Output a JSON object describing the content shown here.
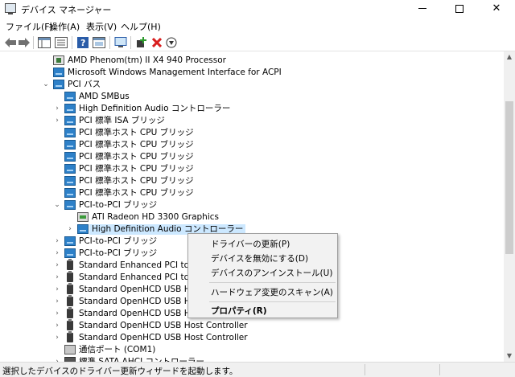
{
  "window": {
    "title": "デバイス マネージャー",
    "min_label": "",
    "max_label": "",
    "close_label": "✕"
  },
  "menubar": {
    "items": [
      "ファイル(F)",
      "操作(A)",
      "表示(V)",
      "ヘルプ(H)"
    ]
  },
  "toolbar": {
    "buttons": [
      "back-arrow-icon",
      "forward-arrow-icon",
      "show-hide-tree-icon",
      "properties-icon",
      "help-icon",
      "action-pane-icon",
      "monitor-icon",
      "add-driver-icon",
      "uninstall-icon",
      "update-driver-icon"
    ]
  },
  "tree": {
    "items": [
      {
        "label": "AMD Phenom(tm) II X4 940 Processor",
        "icon": "cpu-icon",
        "indent": 1,
        "expander": ""
      },
      {
        "label": "Microsoft Windows Management Interface for ACPI",
        "icon": "pci-device-icon",
        "indent": 1,
        "expander": ""
      },
      {
        "label": "PCI バス",
        "icon": "pci-device-icon",
        "indent": 1,
        "expander": "v"
      },
      {
        "label": "AMD SMBus",
        "icon": "pci-device-icon",
        "indent": 2,
        "expander": ""
      },
      {
        "label": "High Definition Audio コントローラー",
        "icon": "pci-device-icon",
        "indent": 2,
        "expander": ">"
      },
      {
        "label": "PCI 標準 ISA ブリッジ",
        "icon": "pci-device-icon",
        "indent": 2,
        "expander": ">"
      },
      {
        "label": "PCI 標準ホスト CPU ブリッジ",
        "icon": "pci-device-icon",
        "indent": 2,
        "expander": ""
      },
      {
        "label": "PCI 標準ホスト CPU ブリッジ",
        "icon": "pci-device-icon",
        "indent": 2,
        "expander": ""
      },
      {
        "label": "PCI 標準ホスト CPU ブリッジ",
        "icon": "pci-device-icon",
        "indent": 2,
        "expander": ""
      },
      {
        "label": "PCI 標準ホスト CPU ブリッジ",
        "icon": "pci-device-icon",
        "indent": 2,
        "expander": ""
      },
      {
        "label": "PCI 標準ホスト CPU ブリッジ",
        "icon": "pci-device-icon",
        "indent": 2,
        "expander": ""
      },
      {
        "label": "PCI 標準ホスト CPU ブリッジ",
        "icon": "pci-device-icon",
        "indent": 2,
        "expander": ""
      },
      {
        "label": "PCI-to-PCI ブリッジ",
        "icon": "pci-device-icon",
        "indent": 2,
        "expander": "v"
      },
      {
        "label": "ATI Radeon HD 3300 Graphics",
        "icon": "display-adapter-icon",
        "indent": 3,
        "expander": ""
      },
      {
        "label": "High Definition Audio コントローラー",
        "icon": "pci-device-icon",
        "indent": 3,
        "expander": ">",
        "selected": true
      },
      {
        "label": "PCI-to-PCI ブリッジ",
        "icon": "pci-device-icon",
        "indent": 2,
        "expander": ">"
      },
      {
        "label": "PCI-to-PCI ブリッジ",
        "icon": "pci-device-icon",
        "indent": 2,
        "expander": ">"
      },
      {
        "label": "Standard Enhanced PCI to USB",
        "icon": "usb-icon",
        "indent": 2,
        "expander": ">"
      },
      {
        "label": "Standard Enhanced PCI to USB",
        "icon": "usb-icon",
        "indent": 2,
        "expander": ">"
      },
      {
        "label": "Standard OpenHCD USB Host C",
        "icon": "usb-icon",
        "indent": 2,
        "expander": ">"
      },
      {
        "label": "Standard OpenHCD USB Host C",
        "icon": "usb-icon",
        "indent": 2,
        "expander": ">"
      },
      {
        "label": "Standard OpenHCD USB Host C",
        "icon": "usb-icon",
        "indent": 2,
        "expander": ">"
      },
      {
        "label": "Standard OpenHCD USB Host Controller",
        "icon": "usb-icon",
        "indent": 2,
        "expander": ">"
      },
      {
        "label": "Standard OpenHCD USB Host Controller",
        "icon": "usb-icon",
        "indent": 2,
        "expander": ">"
      },
      {
        "label": "通信ポート (COM1)",
        "icon": "com-port-icon",
        "indent": 2,
        "expander": ""
      },
      {
        "label": "標準 SATA AHCI コントローラー",
        "icon": "sata-controller-icon",
        "indent": 2,
        "expander": ">"
      }
    ]
  },
  "context_menu": {
    "items": [
      {
        "label": "ドライバーの更新(P)",
        "bold": false
      },
      {
        "label": "デバイスを無効にする(D)",
        "bold": false
      },
      {
        "label": "デバイスのアンインストール(U)",
        "bold": false
      },
      {
        "label": "ハードウェア変更のスキャン(A)",
        "bold": false
      },
      {
        "label": "プロパティ(R)",
        "bold": true
      }
    ]
  },
  "statusbar": {
    "text": "選択したデバイスのドライバー更新ウィザードを起動します。"
  },
  "colors": {
    "selection": "#cce8ff",
    "pci_icon": "#2d80c8",
    "uninstall_red": "#d81e1e",
    "add_green": "#2c9a2c"
  }
}
